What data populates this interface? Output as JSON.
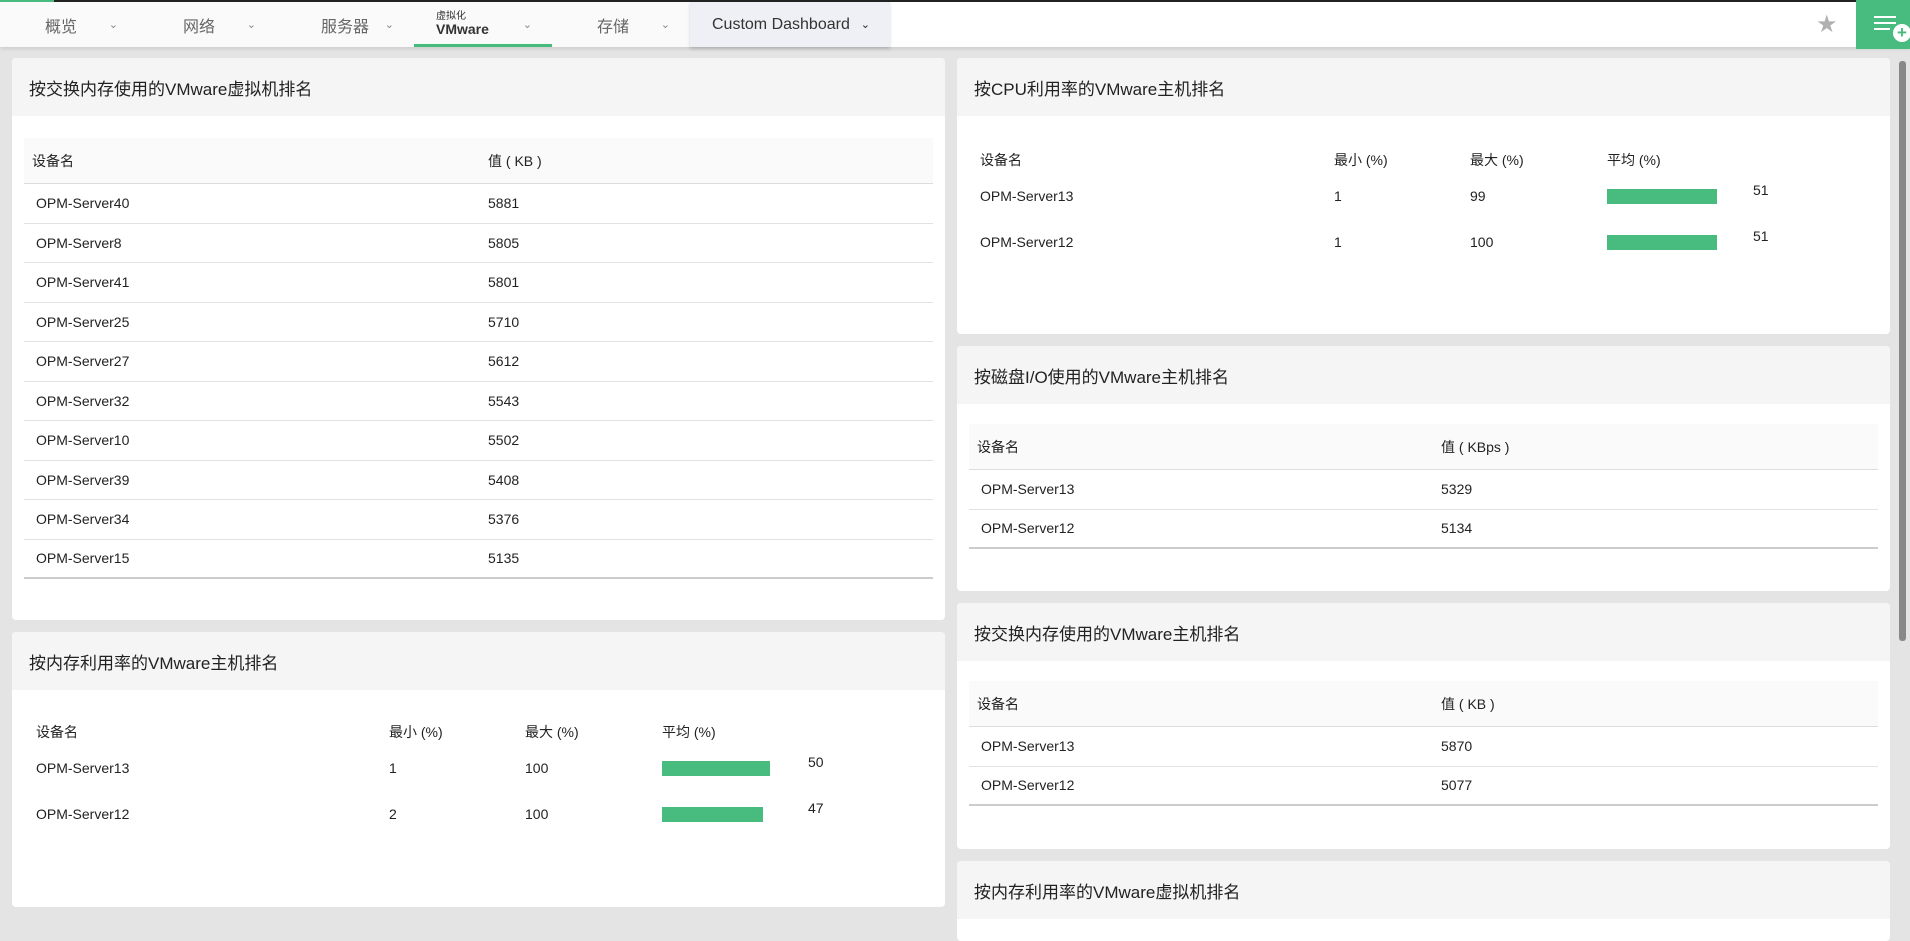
{
  "nav": {
    "tabs": [
      {
        "label": "概览"
      },
      {
        "label": "网络"
      },
      {
        "label": "服务器"
      },
      {
        "sub": "虚拟化",
        "label": "VMware"
      },
      {
        "label": "存储"
      },
      {
        "label": "Custom Dashboard"
      }
    ]
  },
  "accent": "#48bb7e",
  "swap_vm": {
    "title": "按交换内存使用的VMware虚拟机排名",
    "headers": [
      "设备名",
      "值 ( KB )"
    ],
    "rows": [
      [
        "OPM-Server40",
        "5881"
      ],
      [
        "OPM-Server8",
        "5805"
      ],
      [
        "OPM-Server41",
        "5801"
      ],
      [
        "OPM-Server25",
        "5710"
      ],
      [
        "OPM-Server27",
        "5612"
      ],
      [
        "OPM-Server32",
        "5543"
      ],
      [
        "OPM-Server10",
        "5502"
      ],
      [
        "OPM-Server39",
        "5408"
      ],
      [
        "OPM-Server34",
        "5376"
      ],
      [
        "OPM-Server15",
        "5135"
      ]
    ]
  },
  "mem_host": {
    "title": "按内存利用率的VMware主机排名",
    "headers": [
      "设备名",
      "最小 (%)",
      "最大 (%)",
      "平均 (%)"
    ],
    "rows": [
      {
        "name": "OPM-Server13",
        "min": "1",
        "max": "100",
        "avg": 50
      },
      {
        "name": "OPM-Server12",
        "min": "2",
        "max": "100",
        "avg": 47
      }
    ]
  },
  "cpu_host": {
    "title": "按CPU利用率的VMware主机排名",
    "headers": [
      "设备名",
      "最小 (%)",
      "最大 (%)",
      "平均 (%)"
    ],
    "rows": [
      {
        "name": "OPM-Server13",
        "min": "1",
        "max": "99",
        "avg": 51
      },
      {
        "name": "OPM-Server12",
        "min": "1",
        "max": "100",
        "avg": 51
      }
    ]
  },
  "disk_host": {
    "title": "按磁盘I/O使用的VMware主机排名",
    "headers": [
      "设备名",
      "值 ( KBps )"
    ],
    "rows": [
      [
        "OPM-Server13",
        "5329"
      ],
      [
        "OPM-Server12",
        "5134"
      ]
    ]
  },
  "swap_host": {
    "title": "按交换内存使用的VMware主机排名",
    "headers": [
      "设备名",
      "值 ( KB )"
    ],
    "rows": [
      [
        "OPM-Server13",
        "5870"
      ],
      [
        "OPM-Server12",
        "5077"
      ]
    ]
  },
  "mem_vm": {
    "title": "按内存利用率的VMware虚拟机排名"
  }
}
